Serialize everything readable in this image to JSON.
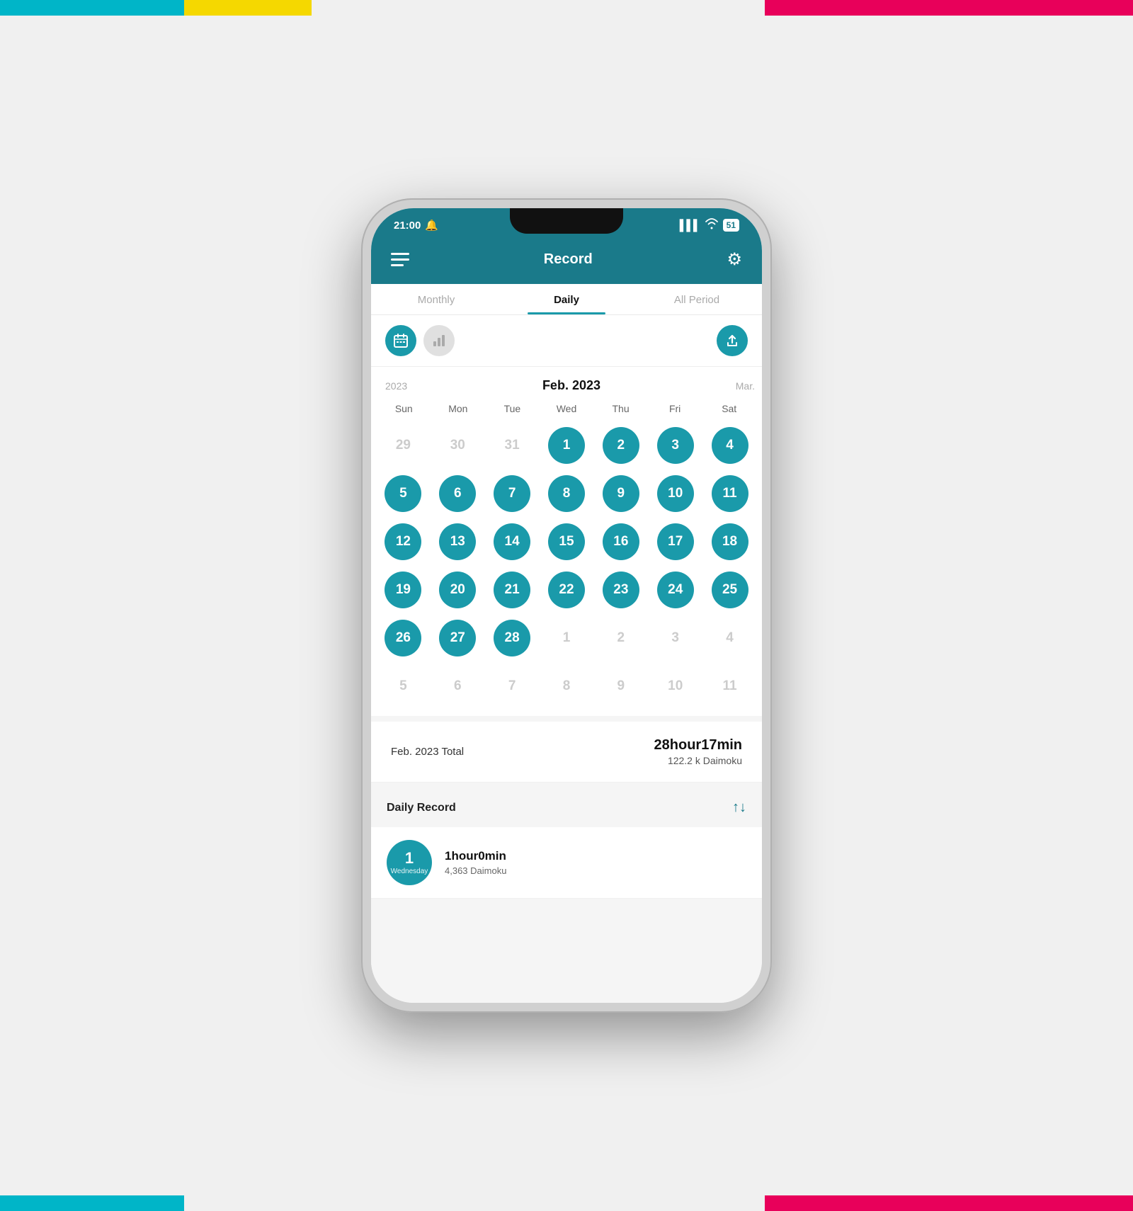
{
  "decorative": {
    "corner_tl_color": "#00b5c8",
    "corner_yellow_color": "#f5d800",
    "corner_pink_color": "#e8005a"
  },
  "status_bar": {
    "time": "21:00",
    "bell_icon": "🔔",
    "signal": "▌▌▌",
    "wifi": "wifi",
    "battery": "51"
  },
  "header": {
    "title": "Record",
    "menu_icon": "☰",
    "settings_icon": "⚙"
  },
  "tabs": [
    {
      "id": "monthly",
      "label": "Monthly",
      "state": "inactive"
    },
    {
      "id": "daily",
      "label": "Daily",
      "state": "active"
    },
    {
      "id": "all_period",
      "label": "All Period",
      "state": "inactive"
    }
  ],
  "toolbar": {
    "calendar_btn_label": "calendar",
    "chart_btn_label": "chart",
    "share_btn_label": "share"
  },
  "calendar": {
    "prev_month": "2023",
    "current_month": "Feb. 2023",
    "next_month": "Mar.",
    "day_headers": [
      "Sun",
      "Mon",
      "Tue",
      "Wed",
      "Thu",
      "Fri",
      "Sat"
    ],
    "weeks": [
      [
        {
          "num": "29",
          "filled": false
        },
        {
          "num": "30",
          "filled": false
        },
        {
          "num": "31",
          "filled": false
        },
        {
          "num": "1",
          "filled": true
        },
        {
          "num": "2",
          "filled": true
        },
        {
          "num": "3",
          "filled": true
        },
        {
          "num": "4",
          "filled": true
        }
      ],
      [
        {
          "num": "5",
          "filled": true
        },
        {
          "num": "6",
          "filled": true
        },
        {
          "num": "7",
          "filled": true
        },
        {
          "num": "8",
          "filled": true
        },
        {
          "num": "9",
          "filled": true
        },
        {
          "num": "10",
          "filled": true
        },
        {
          "num": "11",
          "filled": true
        }
      ],
      [
        {
          "num": "12",
          "filled": true
        },
        {
          "num": "13",
          "filled": true
        },
        {
          "num": "14",
          "filled": true
        },
        {
          "num": "15",
          "filled": true
        },
        {
          "num": "16",
          "filled": true
        },
        {
          "num": "17",
          "filled": true
        },
        {
          "num": "18",
          "filled": true
        }
      ],
      [
        {
          "num": "19",
          "filled": true
        },
        {
          "num": "20",
          "filled": true
        },
        {
          "num": "21",
          "filled": true
        },
        {
          "num": "22",
          "filled": true
        },
        {
          "num": "23",
          "filled": true
        },
        {
          "num": "24",
          "filled": true
        },
        {
          "num": "25",
          "filled": true
        }
      ],
      [
        {
          "num": "26",
          "filled": true
        },
        {
          "num": "27",
          "filled": true
        },
        {
          "num": "28",
          "filled": true
        },
        {
          "num": "1",
          "filled": false
        },
        {
          "num": "2",
          "filled": false
        },
        {
          "num": "3",
          "filled": false
        },
        {
          "num": "4",
          "filled": false
        }
      ],
      [
        {
          "num": "5",
          "filled": false
        },
        {
          "num": "6",
          "filled": false
        },
        {
          "num": "7",
          "filled": false
        },
        {
          "num": "8",
          "filled": false
        },
        {
          "num": "9",
          "filled": false
        },
        {
          "num": "10",
          "filled": false
        },
        {
          "num": "11",
          "filled": false
        }
      ]
    ]
  },
  "summary": {
    "label": "Feb. 2023 Total",
    "time": "28hour17min",
    "daimoku": "122.2 k Daimoku"
  },
  "daily_record": {
    "title": "Daily Record",
    "sort_icon": "↑↓",
    "items": [
      {
        "date_num": "1",
        "date_day": "Wednesday",
        "time": "1hour0min",
        "daimoku": "4,363 Daimoku"
      }
    ]
  }
}
